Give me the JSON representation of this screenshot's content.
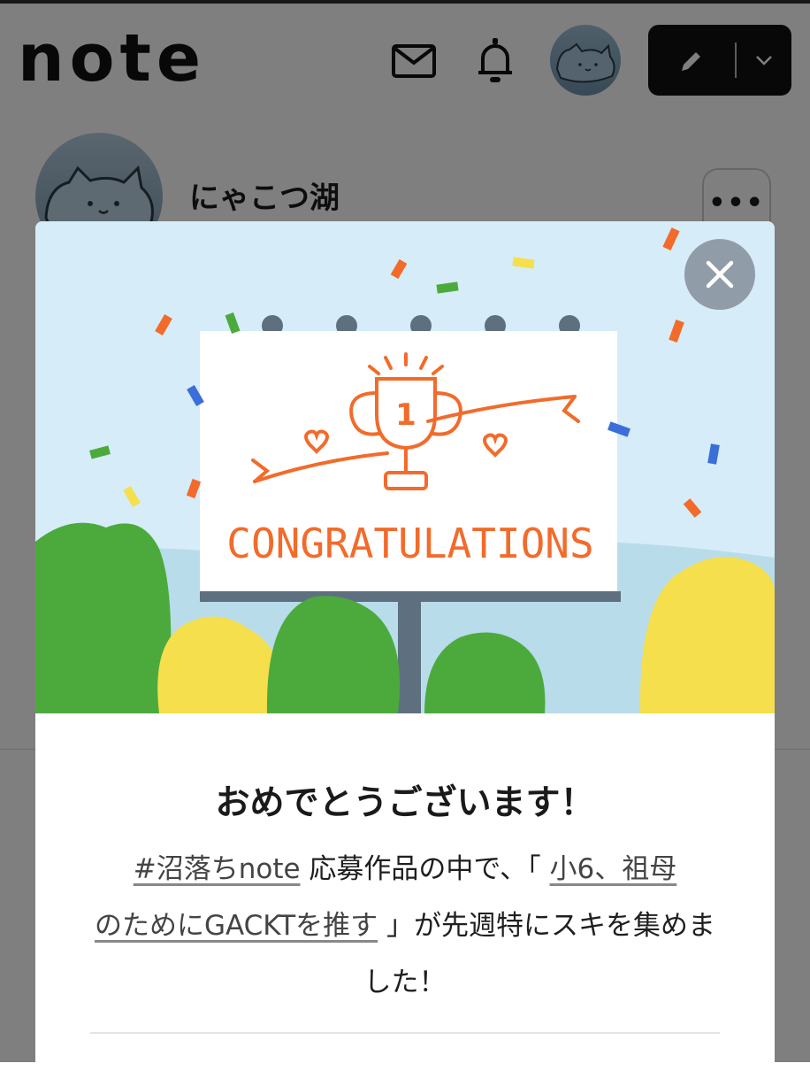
{
  "header": {
    "logo": "note",
    "mail_icon": "mail-icon",
    "bell_icon": "bell-icon",
    "post_icon": "pencil-icon",
    "post_menu_icon": "chevron-down-icon"
  },
  "creator": {
    "name": "にゃこつ湖",
    "more_label": "•••"
  },
  "modal": {
    "billboard_text": "CONGRATULATIONS",
    "trophy_number": "1",
    "title": "おめでとうございます！",
    "hashtag_link": "#沼落ちnote",
    "text_after_hashtag": " 応募作品の中で、「 ",
    "article_link_line1": "小6、祖母",
    "article_link_line2": "のためにGACKTを推す",
    "text_after_article": " 」が先週特にスキを集めました！"
  },
  "colors": {
    "accent_orange": "#f26b2b",
    "sky": "#d6ecf8",
    "tree_green": "#4caa3c",
    "tree_yellow": "#f5df4d",
    "dark": "#111111"
  }
}
